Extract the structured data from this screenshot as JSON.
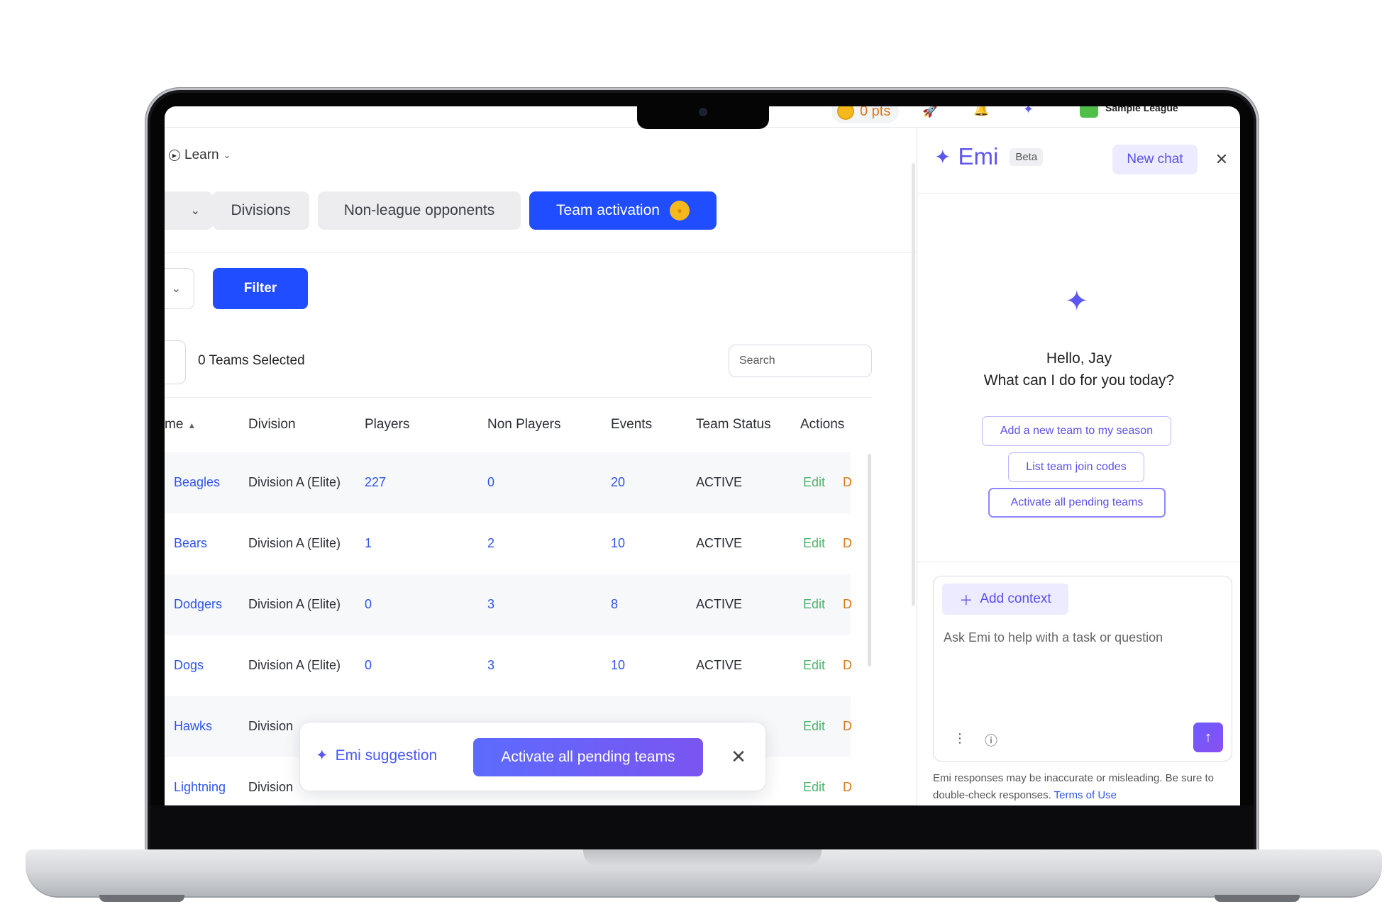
{
  "topbar": {
    "points": "0 pts",
    "league": "Sample League"
  },
  "nav": {
    "learn": "Learn"
  },
  "tabs": [
    {
      "label": "Divisions"
    },
    {
      "label": "Non-league opponents"
    },
    {
      "label": "Team activation"
    }
  ],
  "toolbar": {
    "filter_label": "Filter",
    "selected_count": "0 Teams Selected",
    "search_placeholder": "Search"
  },
  "table": {
    "headers": [
      "me",
      "Division",
      "Players",
      "Non Players",
      "Events",
      "Team Status",
      "Actions"
    ],
    "rows": [
      {
        "name": "Beagles",
        "division": "Division A (Elite)",
        "players": "227",
        "non_players": "0",
        "events": "20",
        "status": "ACTIVE",
        "edit": "Edit",
        "delete": "D"
      },
      {
        "name": "Bears",
        "division": "Division A (Elite)",
        "players": "1",
        "non_players": "2",
        "events": "10",
        "status": "ACTIVE",
        "edit": "Edit",
        "delete": "D"
      },
      {
        "name": "Dodgers",
        "division": "Division A (Elite)",
        "players": "0",
        "non_players": "3",
        "events": "8",
        "status": "ACTIVE",
        "edit": "Edit",
        "delete": "D"
      },
      {
        "name": "Dogs",
        "division": "Division A (Elite)",
        "players": "0",
        "non_players": "3",
        "events": "10",
        "status": "ACTIVE",
        "edit": "Edit",
        "delete": "D"
      },
      {
        "name": "Hawks",
        "division": "Division",
        "players": "",
        "non_players": "",
        "events": "",
        "status": "",
        "edit": "Edit",
        "delete": "D"
      },
      {
        "name": "Lightning",
        "division": "Division",
        "players": "",
        "non_players": "",
        "events": "",
        "status": "",
        "edit": "Edit",
        "delete": "D"
      }
    ]
  },
  "suggestion": {
    "label": "Emi suggestion",
    "action": "Activate all pending teams"
  },
  "emi": {
    "name": "Emi",
    "beta": "Beta",
    "new_chat": "New chat",
    "greeting_1": "Hello, Jay",
    "greeting_2": "What can I do for you today?",
    "chips": [
      "Add a new team to my season",
      "List team join codes",
      "Activate all pending teams"
    ],
    "add_context": "Add context",
    "input_placeholder": "Ask Emi to help with a task or question",
    "disclaimer": "Emi responses may be inaccurate or misleading. Be sure to double-check responses.",
    "terms": "Terms of Use"
  },
  "colors": {
    "primary": "#1f4dff",
    "emi_purple": "#6155f0",
    "link": "#2f55e8",
    "edit": "#4bb36b",
    "coin": "#f5b91d"
  }
}
